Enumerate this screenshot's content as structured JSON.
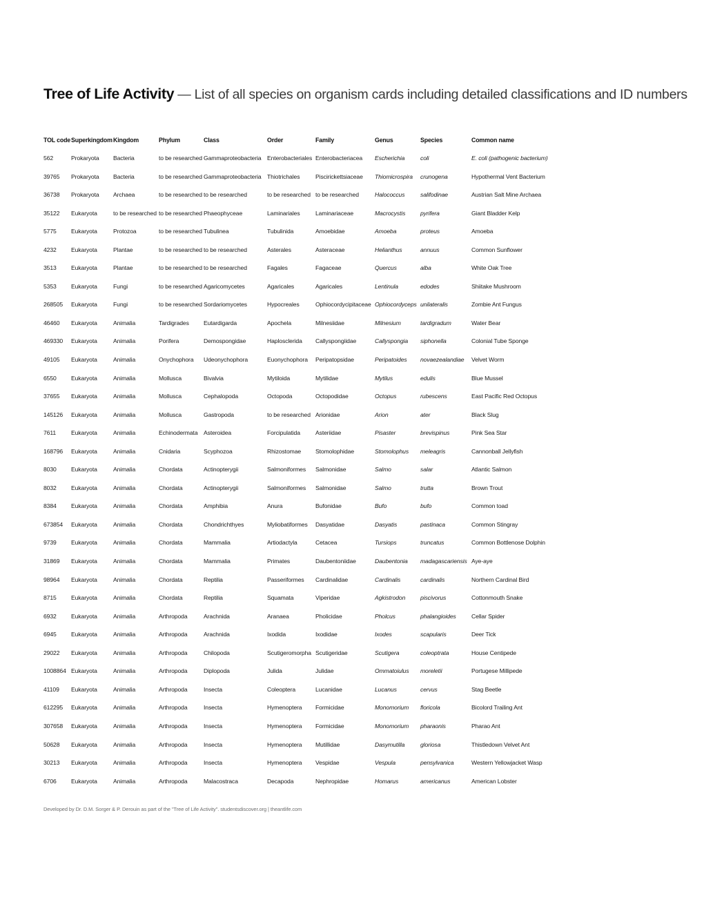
{
  "document": {
    "title_strong": "Tree of Life Activity",
    "title_rest": " — List of all species on organism cards including detailed classifications and ID numbers",
    "footer": "Developed by Dr. D.M. Sorger & P. Derouin as part of the \"Tree of Life Activity\". studentsdiscover.org | theantlife.com",
    "accent_red": "#ee2222",
    "text_color": "#1a1a1a",
    "footer_color": "#6b6b6b",
    "placeholder_text": "to be researched"
  },
  "table": {
    "columns": [
      "TOL code",
      "Superkingdom",
      "Kingdom",
      "Phylum",
      "Class",
      "Order",
      "Family",
      "Genus",
      "Species",
      "Common name"
    ],
    "rows": [
      {
        "tol_code": "562",
        "superkingdom": "Prokaryota",
        "kingdom": "Bacteria",
        "phylum": "to be researched",
        "class": "Gammaproteobacteria",
        "order": "Enterobacteriales",
        "family": "Enterobacteriacea",
        "genus": "Escherichia",
        "species": "coli",
        "common_name": "E. coli (pathogenic bacterium)",
        "common_name_italic": true
      },
      {
        "tol_code": "39765",
        "superkingdom": "Prokaryota",
        "kingdom": "Bacteria",
        "phylum": "to be researched",
        "class": "Gammaproteobacteria",
        "order": "Thiotrichales",
        "family": "Piscirickettsiaceae",
        "genus": "Thiomicrospira",
        "species": "crunogena",
        "common_name": "Hypothermal Vent Bacterium",
        "common_name_italic": false
      },
      {
        "tol_code": "36738",
        "superkingdom": "Prokaryota",
        "kingdom": "Archaea",
        "phylum": "to be researched",
        "class": "to be researched",
        "order": "to be researched",
        "family": "to be researched",
        "genus": "Halococcus",
        "species": "salifodinae",
        "common_name": "Austrian Salt Mine Archaea",
        "common_name_italic": false
      },
      {
        "tol_code": "35122",
        "superkingdom": "Eukaryota",
        "kingdom": "to be researched",
        "phylum": "to be researched",
        "class": "Phaeophyceae",
        "order": "Laminariales",
        "family": "Laminariaceae",
        "genus": "Macrocystis",
        "species": "pyrifera",
        "common_name": "Giant Bladder Kelp",
        "common_name_italic": false
      },
      {
        "tol_code": "5775",
        "superkingdom": "Eukaryota",
        "kingdom": "Protozoa",
        "phylum": "to be researched",
        "class": "Tubulinea",
        "order": "Tubulinida",
        "family": "Amoebidae",
        "genus": "Amoeba",
        "species": "proteus",
        "common_name": "Amoeba",
        "common_name_italic": false
      },
      {
        "tol_code": "4232",
        "superkingdom": "Eukaryota",
        "kingdom": "Plantae",
        "phylum": "to be researched",
        "class": "to be researched",
        "order": "Asterales",
        "family": "Asteraceae",
        "genus": "Helianthus",
        "species": "annuus",
        "common_name": "Common Sunflower",
        "common_name_italic": false
      },
      {
        "tol_code": "3513",
        "superkingdom": "Eukaryota",
        "kingdom": "Plantae",
        "phylum": "to be researched",
        "class": "to be researched",
        "order": "Fagales",
        "family": "Fagaceae",
        "genus": "Quercus",
        "species": "alba",
        "common_name": "White Oak Tree",
        "common_name_italic": false
      },
      {
        "tol_code": "5353",
        "superkingdom": "Eukaryota",
        "kingdom": "Fungi",
        "phylum": "to be researched",
        "class": "Agaricomycetes",
        "order": "Agaricales",
        "family": "Agaricales",
        "genus": "Lentinula",
        "species": "edodes",
        "common_name": "Shiitake Mushroom",
        "common_name_italic": false
      },
      {
        "tol_code": "268505",
        "superkingdom": "Eukaryota",
        "kingdom": "Fungi",
        "phylum": "to be researched",
        "class": "Sordariomycetes",
        "order": "Hypocreales",
        "family": "Ophiocordycipitaceae",
        "genus": "Ophiocordyceps",
        "species": "unilateralis",
        "common_name": "Zombie Ant Fungus",
        "common_name_italic": false
      },
      {
        "tol_code": "46460",
        "superkingdom": "Eukaryota",
        "kingdom": "Animalia",
        "phylum": "Tardigrades",
        "class": "Eutardigarda",
        "order": "Apochela",
        "family": "Milnesiidae",
        "genus": "Milnesium",
        "species": "tardigradum",
        "common_name": "Water Bear",
        "common_name_italic": false
      },
      {
        "tol_code": "469330",
        "superkingdom": "Eukaryota",
        "kingdom": "Animalia",
        "phylum": "Porifera",
        "class": "Demospongidae",
        "order": "Haplosclerida",
        "family": "Callyspongiidae",
        "genus": "Callyspongia",
        "species": "siphonella",
        "common_name": "Colonial Tube Sponge",
        "common_name_italic": false
      },
      {
        "tol_code": "49105",
        "superkingdom": "Eukaryota",
        "kingdom": "Animalia",
        "phylum": "Onychophora",
        "class": "Udeonychophora",
        "order": "Euonychophora",
        "family": "Peripatopsidae",
        "genus": "Peripatoides",
        "species": "novaezealandiae",
        "common_name": "Velvet Worm",
        "common_name_italic": false
      },
      {
        "tol_code": "6550",
        "superkingdom": "Eukaryota",
        "kingdom": "Animalia",
        "phylum": "Mollusca",
        "class": "Bivalvia",
        "order": "Mytiloida",
        "family": "Mytilidae",
        "genus": "Mytilus",
        "species": "edulis",
        "common_name": "Blue Mussel",
        "common_name_italic": false
      },
      {
        "tol_code": "37655",
        "superkingdom": "Eukaryota",
        "kingdom": "Animalia",
        "phylum": "Mollusca",
        "class": "Cephalopoda",
        "order": "Octopoda",
        "family": "Octopodidae",
        "genus": "Octopus",
        "species": "rubescens",
        "common_name": "East Pacific Red Octopus",
        "common_name_italic": false
      },
      {
        "tol_code": "145126",
        "superkingdom": "Eukaryota",
        "kingdom": "Animalia",
        "phylum": "Mollusca",
        "class": "Gastropoda",
        "order": "to be researched",
        "family": "Arionidae",
        "genus": "Arion",
        "species": "ater",
        "common_name": "Black Slug",
        "common_name_italic": false
      },
      {
        "tol_code": "7611",
        "superkingdom": "Eukaryota",
        "kingdom": "Animalia",
        "phylum": "Echinodermata",
        "class": "Asteroidea",
        "order": "Forcipulatida",
        "family": "Asteriidae",
        "genus": "Pisaster",
        "species": "brevispinus",
        "common_name": "Pink Sea Star",
        "common_name_italic": false
      },
      {
        "tol_code": "168796",
        "superkingdom": "Eukaryota",
        "kingdom": "Animalia",
        "phylum": "Cnidaria",
        "class": "Scyphozoa",
        "order": "Rhizostomae",
        "family": "Stomolophidae",
        "genus": "Stomolophus",
        "species": "meleagris",
        "common_name": "Cannonball Jellyfish",
        "common_name_italic": false
      },
      {
        "tol_code": "8030",
        "superkingdom": "Eukaryota",
        "kingdom": "Animalia",
        "phylum": "Chordata",
        "class": "Actinopterygii",
        "order": "Salmoniformes",
        "family": "Salmonidae",
        "genus": "Salmo",
        "species": "salar",
        "common_name": "Atlantic Salmon",
        "common_name_italic": false
      },
      {
        "tol_code": "8032",
        "superkingdom": "Eukaryota",
        "kingdom": "Animalia",
        "phylum": "Chordata",
        "class": "Actinopterygii",
        "order": "Salmoniformes",
        "family": "Salmonidae",
        "genus": "Salmo",
        "species": "trutta",
        "common_name": "Brown Trout",
        "common_name_italic": false
      },
      {
        "tol_code": "8384",
        "superkingdom": "Eukaryota",
        "kingdom": "Animalia",
        "phylum": "Chordata",
        "class": "Amphibia",
        "order": "Anura",
        "family": "Bufonidae",
        "genus": "Bufo",
        "species": "bufo",
        "common_name": "Common toad",
        "common_name_italic": false
      },
      {
        "tol_code": "673854",
        "superkingdom": "Eukaryota",
        "kingdom": "Animalia",
        "phylum": "Chordata",
        "class": "Chondrichthyes",
        "order": "Myliobatiformes",
        "family": "Dasyatidae",
        "genus": "Dasyatis",
        "species": "pastinaca",
        "common_name": "Common Stingray",
        "common_name_italic": false
      },
      {
        "tol_code": "9739",
        "superkingdom": "Eukaryota",
        "kingdom": "Animalia",
        "phylum": "Chordata",
        "class": "Mammalia",
        "order": "Artiodactyla",
        "family": "Cetacea",
        "genus": "Tursiops",
        "species": "truncatus",
        "common_name": "Common Bottlenose Dolphin",
        "common_name_italic": false
      },
      {
        "tol_code": "31869",
        "superkingdom": "Eukaryota",
        "kingdom": "Animalia",
        "phylum": "Chordata",
        "class": "Mammalia",
        "order": "Primates",
        "family": "Daubentoniidae",
        "genus": "Daubentonia",
        "species": "madagascariensis",
        "common_name": "Aye-aye",
        "common_name_italic": false
      },
      {
        "tol_code": "98964",
        "superkingdom": "Eukaryota",
        "kingdom": "Animalia",
        "phylum": "Chordata",
        "class": "Reptilia",
        "order": "Passeriformes",
        "family": "Cardinalidae",
        "genus": "Cardinalis",
        "species": "cardinalis",
        "common_name": "Northern Cardinal Bird",
        "common_name_italic": false
      },
      {
        "tol_code": "8715",
        "superkingdom": "Eukaryota",
        "kingdom": "Animalia",
        "phylum": "Chordata",
        "class": "Reptilia",
        "order": "Squamata",
        "family": "Viperidae",
        "genus": "Agkistrodon",
        "species": "piscivorus",
        "common_name": "Cottonmouth Snake",
        "common_name_italic": false
      },
      {
        "tol_code": "6932",
        "superkingdom": "Eukaryota",
        "kingdom": "Animalia",
        "phylum": "Arthropoda",
        "class": "Arachnida",
        "order": "Aranaea",
        "family": "Pholicidae",
        "genus": "Pholcus",
        "species": "phalangioides",
        "common_name": "Cellar Spider",
        "common_name_italic": false
      },
      {
        "tol_code": "6945",
        "superkingdom": "Eukaryota",
        "kingdom": "Animalia",
        "phylum": "Arthropoda",
        "class": "Arachnida",
        "order": "Ixodida",
        "family": "Ixodidae",
        "genus": "Ixodes",
        "species": "scapularis",
        "common_name": "Deer Tick",
        "common_name_italic": false
      },
      {
        "tol_code": "29022",
        "superkingdom": "Eukaryota",
        "kingdom": "Animalia",
        "phylum": "Arthropoda",
        "class": "Chilopoda",
        "order": "Scutigeromorpha",
        "family": "Scutigeridae",
        "genus": "Scutigera",
        "species": "coleoptrata",
        "common_name": "House Centipede",
        "common_name_italic": false
      },
      {
        "tol_code": "1008864",
        "superkingdom": "Eukaryota",
        "kingdom": "Animalia",
        "phylum": "Arthropoda",
        "class": "Diplopoda",
        "order": "Julida",
        "family": "Julidae",
        "genus": "Ommatoiulus",
        "species": "moreletii",
        "common_name": "Portugese Millipede",
        "common_name_italic": false
      },
      {
        "tol_code": "41109",
        "superkingdom": "Eukaryota",
        "kingdom": "Animalia",
        "phylum": "Arthropoda",
        "class": "Insecta",
        "order": "Coleoptera",
        "family": "Lucanidae",
        "genus": "Lucanus",
        "species": "cervus",
        "common_name": "Stag Beetle",
        "common_name_italic": false
      },
      {
        "tol_code": "612295",
        "superkingdom": "Eukaryota",
        "kingdom": "Animalia",
        "phylum": "Arthropoda",
        "class": "Insecta",
        "order": "Hymenoptera",
        "family": "Formicidae",
        "genus": "Monomorium",
        "species": "floricola",
        "common_name": "Bicolord Trailing Ant",
        "common_name_italic": false
      },
      {
        "tol_code": "307658",
        "superkingdom": "Eukaryota",
        "kingdom": "Animalia",
        "phylum": "Arthropoda",
        "class": "Insecta",
        "order": "Hymenoptera",
        "family": "Formicidae",
        "genus": "Monomorium",
        "species": "pharaonis",
        "common_name": "Pharao Ant",
        "common_name_italic": false
      },
      {
        "tol_code": "50628",
        "superkingdom": "Eukaryota",
        "kingdom": "Animalia",
        "phylum": "Arthropoda",
        "class": "Insecta",
        "order": "Hymenoptera",
        "family": "Mutillidae",
        "genus": "Dasymutilla",
        "species": "gloriosa",
        "common_name": "Thistledown Velvet Ant",
        "common_name_italic": false
      },
      {
        "tol_code": "30213",
        "superkingdom": "Eukaryota",
        "kingdom": "Animalia",
        "phylum": "Arthropoda",
        "class": "Insecta",
        "order": "Hymenoptera",
        "family": "Vespidae",
        "genus": "Vespula",
        "species": "pensylvanica",
        "common_name": "Western Yellowjacket Wasp",
        "common_name_italic": false
      },
      {
        "tol_code": "6706",
        "superkingdom": "Eukaryota",
        "kingdom": "Animalia",
        "phylum": "Arthropoda",
        "class": "Malacostraca",
        "order": "Decapoda",
        "family": "Nephropidae",
        "genus": "Homarus",
        "species": "americanus",
        "common_name": "American Lobster",
        "common_name_italic": false
      }
    ]
  }
}
